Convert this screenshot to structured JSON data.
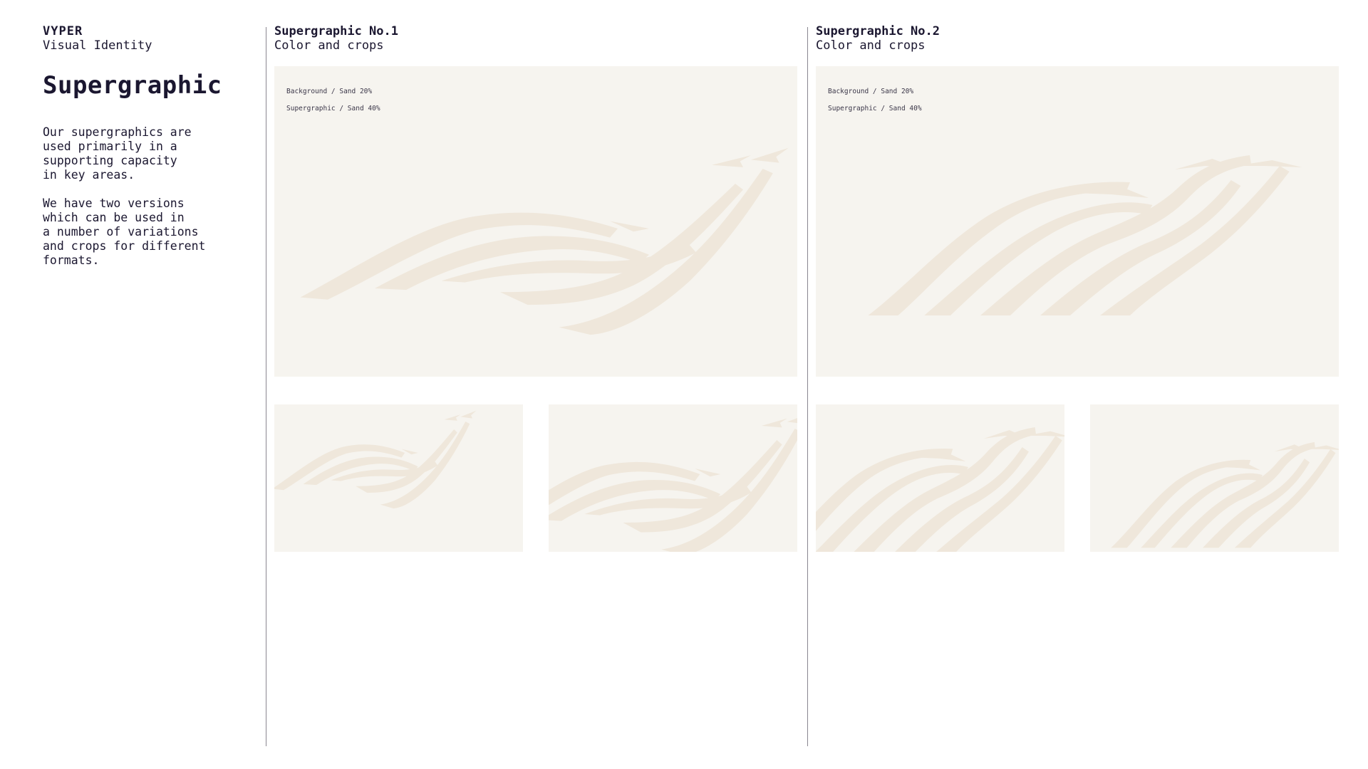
{
  "brand": {
    "name": "VYPER",
    "subtitle": "Visual Identity"
  },
  "page": {
    "title": "Supergraphic",
    "description_1": "Our supergraphics are\nused primarily in a\nsupporting capacity\nin key areas.",
    "description_2": "We have two versions\nwhich can be used in\na number of variations\nand crops for different\nformats."
  },
  "sections": [
    {
      "title": "Supergraphic No.1",
      "subtitle": "Color and crops",
      "note_line_1": "Background / Sand 20%",
      "note_line_2": "Supergraphic / Sand 40%"
    },
    {
      "title": "Supergraphic No.2",
      "subtitle": "Color and crops",
      "note_line_1": "Background / Sand 20%",
      "note_line_2": "Supergraphic / Sand 40%"
    }
  ],
  "colors": {
    "background_sand_20": "#f6f4ef",
    "supergraphic_sand_40": "#efe7db",
    "text": "#1b1730",
    "divider": "#8a8790"
  }
}
